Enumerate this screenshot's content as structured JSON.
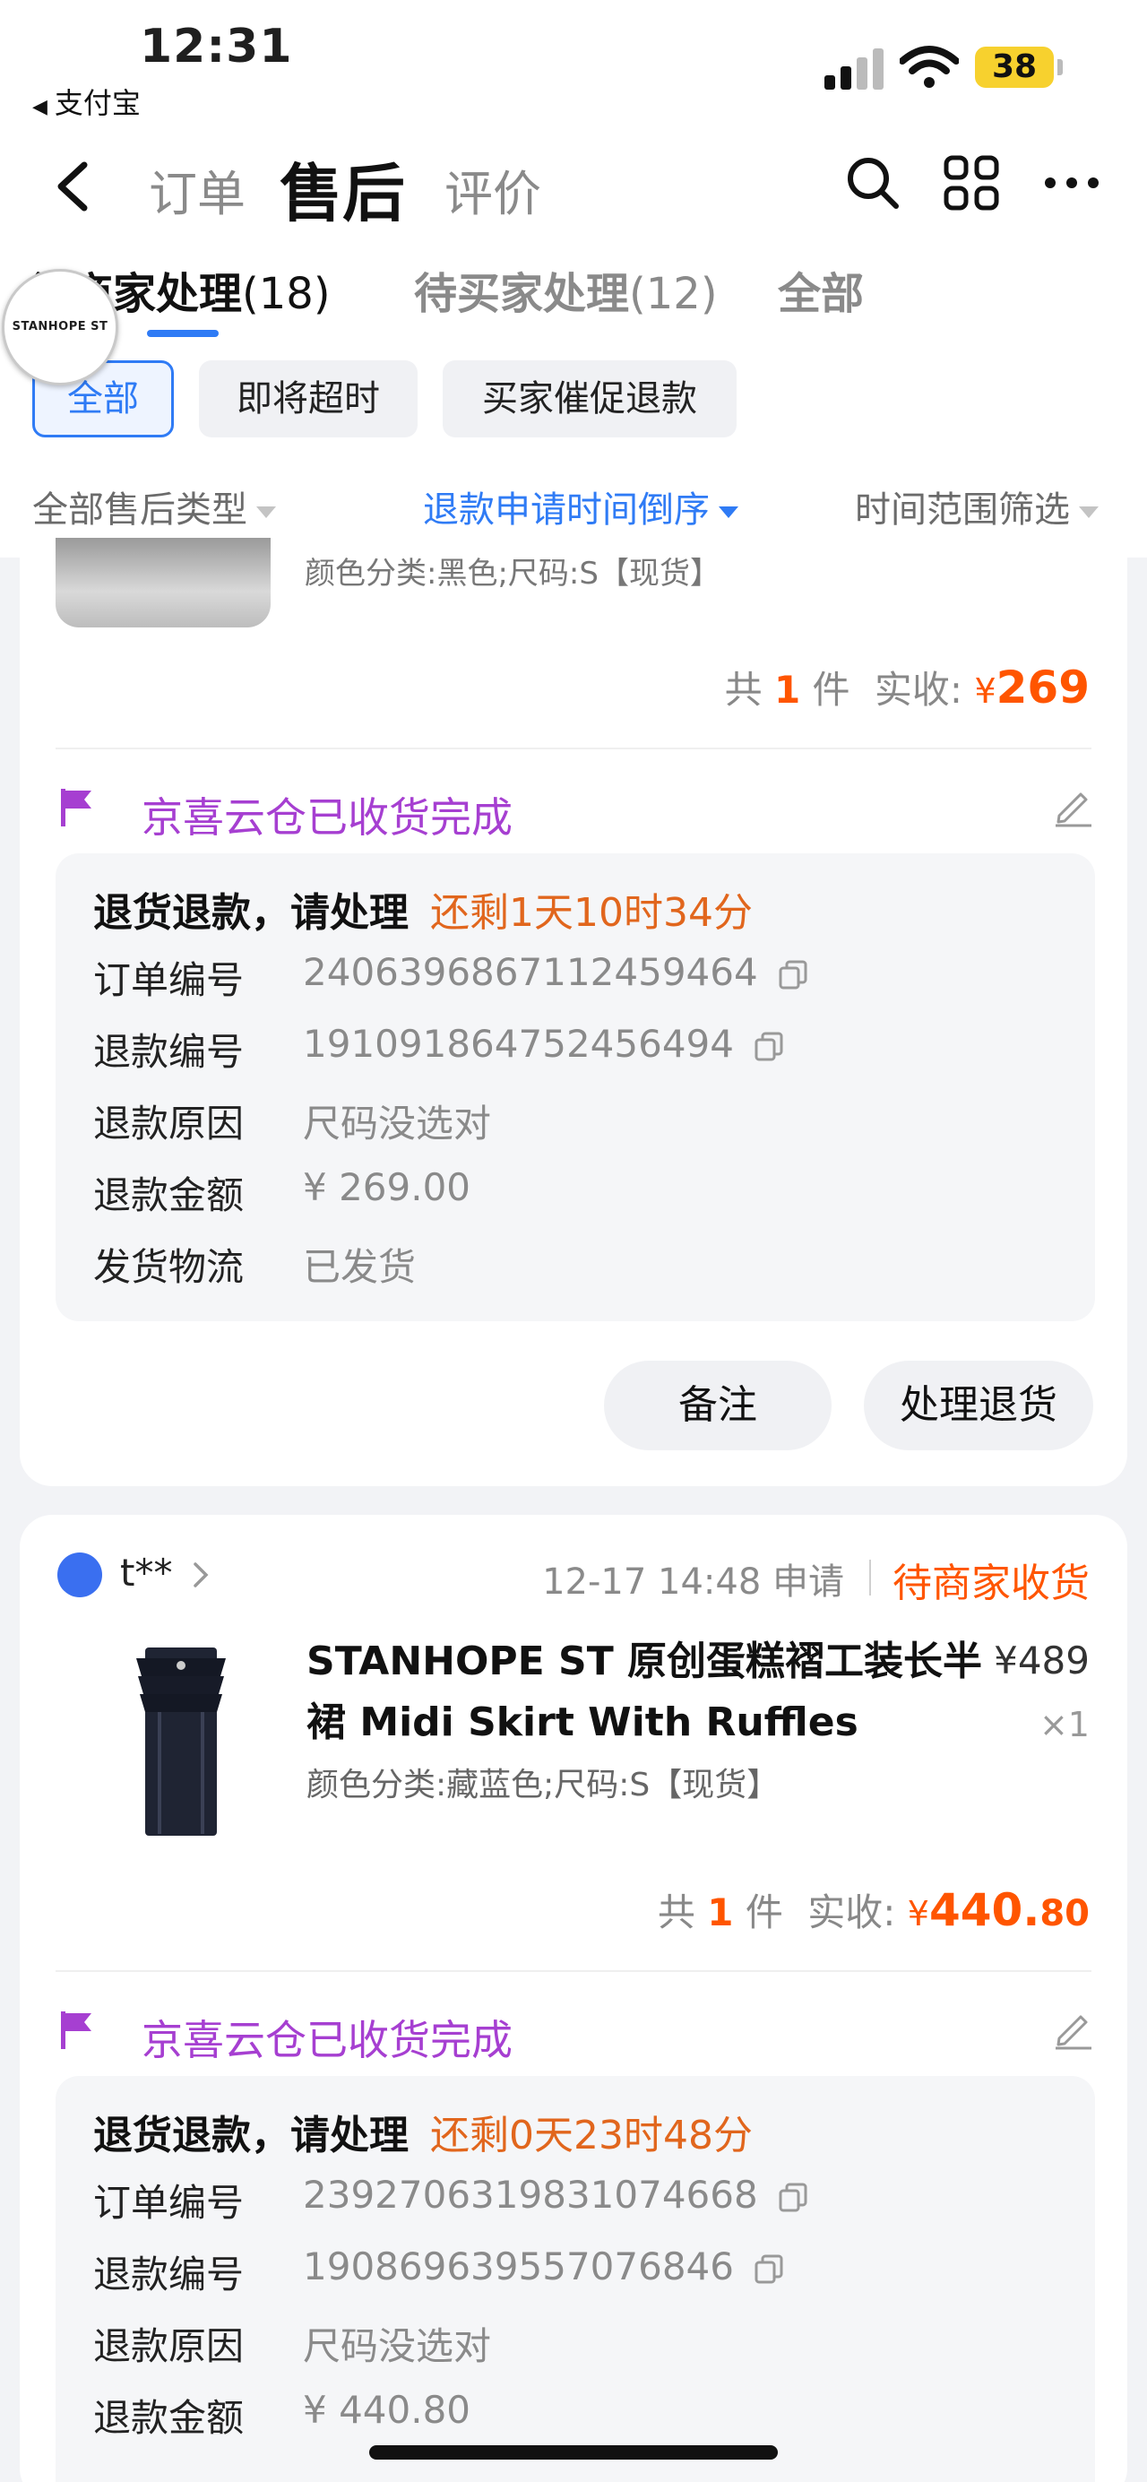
{
  "status_bar": {
    "time": "12:31",
    "back_app": "支付宝",
    "battery": "38"
  },
  "nav": {
    "tabs": [
      "订单",
      "售后",
      "评价"
    ],
    "active_tab": "售后"
  },
  "subtabs": [
    {
      "label": "待商家处理",
      "count": "(18)"
    },
    {
      "label": "待买家处理",
      "count": "(12)"
    },
    {
      "label": "全部",
      "count": ""
    }
  ],
  "store_logo_text": "STANHOPE ST",
  "chips": [
    "全部",
    "即将超时",
    "买家催促退款"
  ],
  "filters": [
    "全部售后类型",
    "退款申请时间倒序",
    "时间范围筛选"
  ],
  "orders": [
    {
      "partial_sku": "颜色分类:黑色;尺码:S【现货】",
      "total_prefix": "共",
      "total_qty": "1",
      "total_unit": "件",
      "total_label": "实收:",
      "currency": "¥",
      "total_amount": "269",
      "total_cents": "",
      "flag_text": "京喜云仓已收货完成",
      "info_title": "退货退款，请处理",
      "countdown": "还剩1天10时34分",
      "rows": [
        {
          "label": "订单编号",
          "value": "2406396867112459464"
        },
        {
          "label": "退款编号",
          "value": "191091864752456494"
        },
        {
          "label": "退款原因",
          "value": "尺码没选对"
        },
        {
          "label": "退款金额",
          "value": "¥ 269.00"
        },
        {
          "label": "发货物流",
          "value": "已发货"
        }
      ],
      "buttons": [
        "备注",
        "处理退货"
      ]
    },
    {
      "buyer": "t**",
      "applied": "12-17 14:48 申请",
      "status": "待商家收货",
      "product_title": "STANHOPE ST 原创蛋糕褶工装长半裙 Midi Skirt With Ruffles",
      "sku": "颜色分类:藏蓝色;尺码:S【现货】",
      "price": "¥489",
      "qty": "×1",
      "total_prefix": "共",
      "total_qty": "1",
      "total_unit": "件",
      "total_label": "实收:",
      "currency": "¥",
      "total_amount": "440.",
      "total_cents": "80",
      "flag_text": "京喜云仓已收货完成",
      "info_title": "退货退款，请处理",
      "countdown": "还剩0天23时48分",
      "rows": [
        {
          "label": "订单编号",
          "value": "2392706319831074668"
        },
        {
          "label": "退款编号",
          "value": "190869639557076846"
        },
        {
          "label": "退款原因",
          "value": "尺码没选对"
        },
        {
          "label": "退款金额",
          "value": "¥ 440.80"
        }
      ]
    }
  ],
  "colors": {
    "accent": "#2f7bf5",
    "price": "#ff5500",
    "flag": "#a63fd1",
    "countdown": "#e1661d"
  }
}
